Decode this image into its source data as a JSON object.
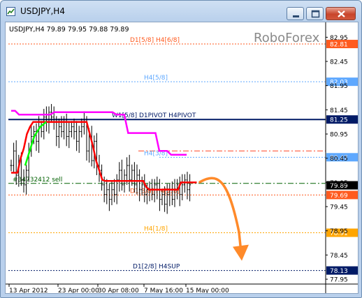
{
  "window": {
    "title": "USDJPY,H4",
    "icons": [
      "chart-app-icon",
      "minimize-icon",
      "maximize-icon",
      "close-icon"
    ]
  },
  "chart_header": "USDJPY,H4  79.89 79.95 79.88 79.89",
  "watermark": "RoboForex",
  "chart_data": {
    "type": "candlestick",
    "symbol": "USDJPY",
    "timeframe": "H4",
    "ohlc_current": {
      "open": 79.89,
      "high": 79.95,
      "low": 79.88,
      "close": 79.89
    },
    "ylim": [
      77.85,
      83.2
    ],
    "y_ticks": [
      "82.95",
      "82.45",
      "81.95",
      "81.45",
      "80.95",
      "80.45",
      "79.95",
      "79.45",
      "78.95",
      "78.45",
      "77.95"
    ],
    "x_ticks": [
      "13 Apr 2012",
      "23 Apr 00:00",
      "30 Apr 08:00",
      "7 May 16:00",
      "15 May 00:00"
    ],
    "close_series": [
      80.3,
      80.6,
      80.1,
      80.4,
      80.0,
      79.9,
      80.2,
      80.6,
      80.9,
      81.0,
      80.8,
      81.1,
      81.0,
      81.3,
      81.2,
      81.4,
      81.3,
      81.2,
      80.9,
      81.1,
      81.0,
      81.2,
      80.9,
      81.0,
      81.1,
      81.0,
      80.8,
      81.0,
      81.1,
      81.2,
      80.6,
      80.9,
      80.4,
      80.8,
      80.3,
      80.2,
      79.9,
      79.7,
      79.8,
      79.6,
      79.8,
      79.7,
      80.0,
      80.2,
      79.9,
      80.1,
      80.3,
      80.0,
      80.2,
      79.9,
      80.1,
      79.8,
      79.9,
      79.7,
      79.8,
      79.8,
      79.7,
      79.9,
      79.8,
      79.6,
      79.7,
      79.5,
      79.7,
      79.8,
      79.6,
      79.8,
      79.9,
      79.7,
      79.9,
      80.0,
      79.8,
      79.9
    ],
    "moving_averages": [
      {
        "color": "#ff00ff",
        "values": [
          81.43,
          81.43,
          81.35,
          81.35,
          81.35,
          81.35,
          81.35,
          81.35,
          81.35,
          81.35,
          81.35,
          81.4,
          81.4,
          81.4,
          81.4,
          81.4,
          81.4,
          81.4,
          81.4,
          81.4,
          81.4,
          81.4,
          81.4,
          81.4,
          81.4,
          81.4,
          81.4,
          81.35,
          81.35,
          81.35,
          80.97,
          80.97,
          80.97,
          80.97,
          80.97,
          80.97,
          80.97,
          80.97,
          80.6,
          80.6,
          80.6,
          80.52,
          80.52,
          80.52,
          80.52,
          80.52
        ]
      },
      {
        "color": "#ff0000",
        "values": [
          80.15,
          80.15,
          80.15,
          80.45,
          80.65,
          80.95,
          81.1,
          81.2,
          81.2,
          81.2,
          81.2,
          81.2,
          81.2,
          81.2,
          81.2,
          81.2,
          81.2,
          81.2,
          81.2,
          81.2,
          81.2,
          81.2,
          81.2,
          81.2,
          81.2,
          80.95,
          80.7,
          80.4,
          80.2,
          80.0,
          79.98,
          79.98,
          79.98,
          79.98,
          79.98,
          79.98,
          79.98,
          79.98,
          79.98,
          79.98,
          79.98,
          79.98,
          79.98,
          79.85,
          79.8,
          79.8,
          79.8,
          79.8,
          79.8,
          79.8,
          79.8,
          79.8,
          79.8,
          79.8,
          79.95,
          79.95,
          79.95,
          79.95,
          79.95,
          79.95
        ]
      },
      {
        "color": "#00ff00",
        "values": [
          80.3,
          80.5,
          80.7,
          80.9,
          81.0,
          81.1,
          81.15,
          81.2
        ]
      }
    ],
    "levels": [
      {
        "label": "D1[5/8] H4[6/8]",
        "value": 82.81,
        "tag": "82.81",
        "color": "#ff5a1e",
        "tag_bg": "#ff5a1e",
        "style": "dotted"
      },
      {
        "label": "H4[5/8]",
        "value": 82.03,
        "tag": "82.03",
        "color": "#5ea8ff",
        "tag_bg": "#5ea8ff",
        "style": "dotted"
      },
      {
        "label": "W1[5/8] D1PIVOT H4PIVOT",
        "value": 81.25,
        "tag": "81.25",
        "color": "#001a66",
        "tag_bg": "#001a66",
        "style": "solid"
      },
      {
        "label": "",
        "value": 80.6,
        "tag": "",
        "color": "#ff4422",
        "tag_bg": "",
        "style": "dashdot"
      },
      {
        "label": "H4[3/8]",
        "value": 80.47,
        "tag": "80.47",
        "color": "#5ea8ff",
        "tag_bg": "#5ea8ff",
        "style": "dotted"
      },
      {
        "label": "#34732412 sell",
        "value": 79.93,
        "tag": "",
        "color": "#006000",
        "tag_bg": "",
        "style": "dashdot"
      },
      {
        "label": "D1[3/8] H4[2/8]",
        "value": 79.69,
        "tag": "79.69",
        "color": "#ff5a1e",
        "tag_bg": "#ff5a1e",
        "style": "dotted"
      },
      {
        "label": "H4[1/8]",
        "value": 78.91,
        "tag": "78.91",
        "color": "#ffa500",
        "tag_bg": "#ffa500",
        "style": "dotted"
      },
      {
        "label": "D1[2/8] H4SUP",
        "value": 78.13,
        "tag": "78.13",
        "color": "#001a66",
        "tag_bg": "#001a66",
        "style": "dotted"
      }
    ],
    "current_price_tag": {
      "value": 79.89,
      "tag": "79.89"
    },
    "forecast_arrow": {
      "color": "#ff8a2a",
      "from_value": 79.9,
      "to_value": 78.1,
      "direction": "down"
    },
    "grid": false
  }
}
